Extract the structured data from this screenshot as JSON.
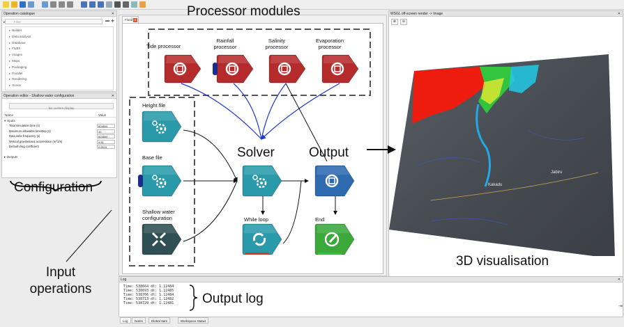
{
  "toolbar": {
    "tools": [
      "new-icon",
      "open-icon",
      "save-icon",
      "undo-icon",
      "redo-icon",
      "cut-icon",
      "copy-icon",
      "paste-icon",
      "zoom-in-icon",
      "zoom-out-icon",
      "zoom-fit-icon",
      "select-icon",
      "run-icon",
      "grid-icon",
      "align-icon",
      "export-icon"
    ]
  },
  "catalogue": {
    "title": "Operation catalogue",
    "filter_placeholder": "Filter",
    "items": [
      "Builder",
      "Data analysis",
      "Database",
      "FluBS",
      "Images",
      "Maps",
      "Packaging",
      "Parallel",
      "Rendering",
      "Scene"
    ]
  },
  "editor": {
    "title": "Operation editor - Shallow water configuration",
    "no_custom": "No custom display",
    "col_name": "Name",
    "col_value": "Value",
    "inputs_label": "Inputs",
    "outputs_label": "Outputs",
    "rows": [
      {
        "name": "Total simulation time (s)",
        "value": "604800"
      },
      {
        "name": "Maximum allowable timestep (s)",
        "value": "10"
      },
      {
        "name": "Data write frequency (s)",
        "value": "604800"
      },
      {
        "name": "Vertical gravitational acceleration (m^2/s)",
        "value": "9.81"
      },
      {
        "name": "Default drag coefficient",
        "value": "0.0015"
      }
    ]
  },
  "canvas": {
    "tab_label": "Flood",
    "close_label": "x"
  },
  "nodes": {
    "tide": "Tide processor",
    "rainfall": "Rainfall processor",
    "salinity": "Salinity processor",
    "evaporation": "Evaporation processor",
    "height": "Height file",
    "base": "Base file",
    "shallow": "Shallow water configuration",
    "while": "While loop",
    "end": "End"
  },
  "render": {
    "title": "WSGL off-screen render -> Image",
    "places": [
      "Kakadu",
      "Jabiru"
    ]
  },
  "log": {
    "title": "Log",
    "lines": [
      "Time: 538664 dt: 1.12484",
      "Time: 538693 dt: 1.12485",
      "Time: 538706 dt: 1.12484",
      "Time: 538713 dt: 1.12482",
      "Time: 538729 dt: 1.12481"
    ]
  },
  "bottom_tabs": [
    "Log",
    "Notes",
    "Global Vars",
    "Workspace Status"
  ],
  "annotations": {
    "processor_modules": "Processor modules",
    "solver": "Solver",
    "output": "Output",
    "configuration": "Configuration",
    "input_operations": "Input operations",
    "visualisation": "3D visualisation",
    "output_log": "Output log"
  },
  "colors": {
    "red_node": "#b52b2c",
    "teal_node": "#2a9aaa",
    "blue_node": "#2d6ab0",
    "green_node": "#3aa83a",
    "dark_node": "#2f4f55",
    "link_blue": "#1c35d6",
    "map_red": "#ee1c0e"
  }
}
